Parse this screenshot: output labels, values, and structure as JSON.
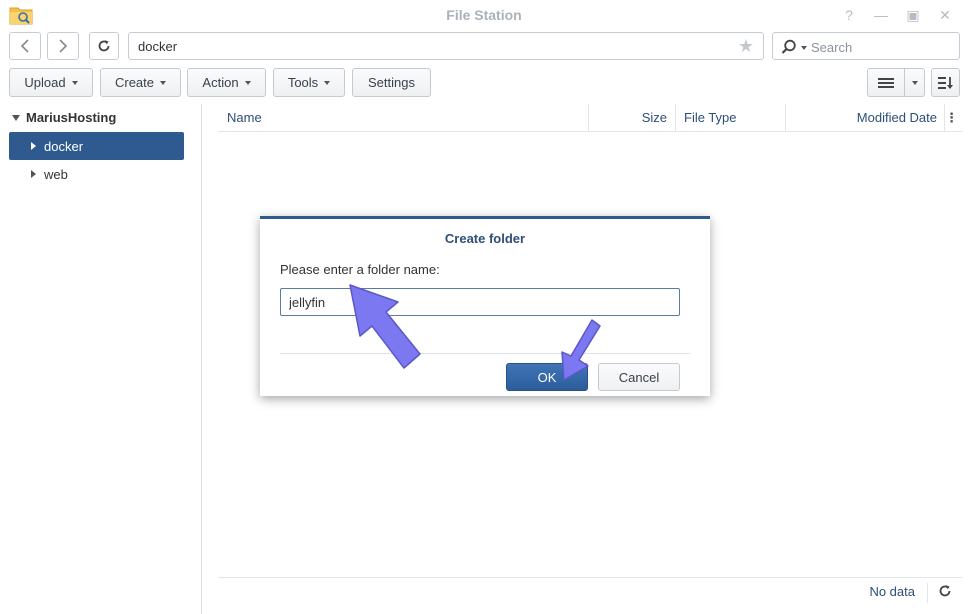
{
  "window": {
    "title": "File Station",
    "icons": [
      "folder-search-icon",
      "help-icon",
      "minimize-icon",
      "maximize-icon",
      "close-icon"
    ]
  },
  "nav": {
    "path": "docker",
    "search_placeholder": "Search"
  },
  "toolbar": {
    "upload_label": "Upload",
    "create_label": "Create",
    "action_label": "Action",
    "tools_label": "Tools",
    "settings_label": "Settings"
  },
  "tree": {
    "root_label": "MariusHosting",
    "items": [
      {
        "label": "docker",
        "selected": true
      },
      {
        "label": "web",
        "selected": false
      }
    ]
  },
  "list": {
    "columns": {
      "name": "Name",
      "size": "Size",
      "file_type": "File Type",
      "modified_date": "Modified Date"
    },
    "status": "No data"
  },
  "dialog": {
    "title": "Create folder",
    "prompt": "Please enter a folder name:",
    "folder_name_value": "jellyfin",
    "ok_label": "OK",
    "cancel_label": "Cancel"
  },
  "colors": {
    "accent": "#2e5a8f",
    "header_text": "#2d4f76",
    "annotation_arrow": "#7b78f2"
  }
}
